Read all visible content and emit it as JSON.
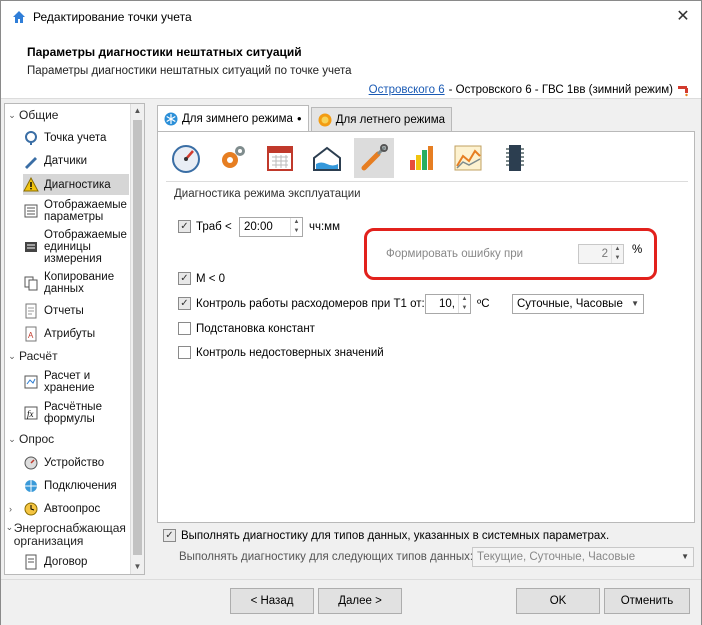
{
  "window": {
    "title": "Редактирование точки учета",
    "close_glyph": "✕"
  },
  "header": {
    "title": "Параметры диагностики нештатных ситуаций",
    "subtitle": "Параметры диагностики нештатных ситуаций по точке учета",
    "location_link": "Островского 6",
    "location_text": "- Островского 6 - ГВС 1вв (зимний режим)"
  },
  "sidebar": {
    "groups": [
      {
        "label": "Общие",
        "expanded": true
      },
      {
        "label": "Расчёт",
        "expanded": true
      },
      {
        "label": "Опрос",
        "expanded": true
      },
      {
        "label": "Энергоснабжающая организация",
        "expanded": true
      }
    ],
    "items": [
      {
        "label": "Точка учета",
        "icon": "meter-point-icon"
      },
      {
        "label": "Датчики",
        "icon": "sensor-icon"
      },
      {
        "label": "Диагностика",
        "icon": "warning-icon",
        "selected": true
      },
      {
        "label": "Отображаемые параметры",
        "icon": "parameters-icon"
      },
      {
        "label": "Отображаемые единицы измерения",
        "icon": "units-icon"
      },
      {
        "label": "Копирование данных",
        "icon": "copy-icon"
      },
      {
        "label": "Отчеты",
        "icon": "report-icon"
      },
      {
        "label": "Атрибуты",
        "icon": "attributes-icon"
      },
      {
        "label": "Расчет и хранение",
        "icon": "calc-storage-icon"
      },
      {
        "label": "Расчётные формулы",
        "icon": "formula-icon"
      },
      {
        "label": "Устройство",
        "icon": "device-icon"
      },
      {
        "label": "Подключения",
        "icon": "connection-icon"
      },
      {
        "label": "Автоопрос",
        "icon": "clock-icon"
      },
      {
        "label": "Договор",
        "icon": "contract-icon"
      }
    ]
  },
  "tabs": [
    {
      "label": "Для зимнего режима",
      "icon": "snowflake-icon",
      "active": true,
      "marker": "●"
    },
    {
      "label": "Для летнего режима",
      "icon": "sun-icon",
      "active": false
    }
  ],
  "toolbar_icons": [
    "gauge-icon",
    "gears-icon",
    "calendar-icon",
    "water-level-icon",
    "diagnostic-tools-icon",
    "bar-chart-icon",
    "line-chart-icon",
    "chip-icon"
  ],
  "diagnostics": {
    "section_title": "Диагностика режима эксплуатации",
    "trab": {
      "label": "Траб <",
      "checked": true,
      "value": "20:00",
      "unit": "чч:мм"
    },
    "error_threshold": {
      "label": "Формировать ошибку при",
      "value": "2",
      "unit": "%"
    },
    "m_less_zero": {
      "label": "M < 0",
      "checked": true
    },
    "flowmeter_control": {
      "label": "Контроль работы расходомеров при Т1 от:",
      "checked": true,
      "value": "10,",
      "unit": "ºС",
      "select": "Суточные, Часовые"
    },
    "const_substitution": {
      "label": "Подстановка констант",
      "checked": false
    },
    "unreliable_control": {
      "label": "Контроль недостоверных значений",
      "checked": false
    }
  },
  "bottom": {
    "system_types": {
      "label": "Выполнять диагностику для типов данных, указанных в системных параметрах.",
      "checked": true
    },
    "following_types_label": "Выполнять диагностику для следующих типов данных:",
    "following_types_value": "Текущие, Суточные, Часовые"
  },
  "buttons": {
    "back": "< Назад",
    "next": "Далее >",
    "ok": "OK",
    "cancel": "Отменить"
  },
  "colors": {
    "highlight": "#e2211c",
    "link": "#1a5ab4",
    "selected_bg": "#d6d6d6"
  }
}
